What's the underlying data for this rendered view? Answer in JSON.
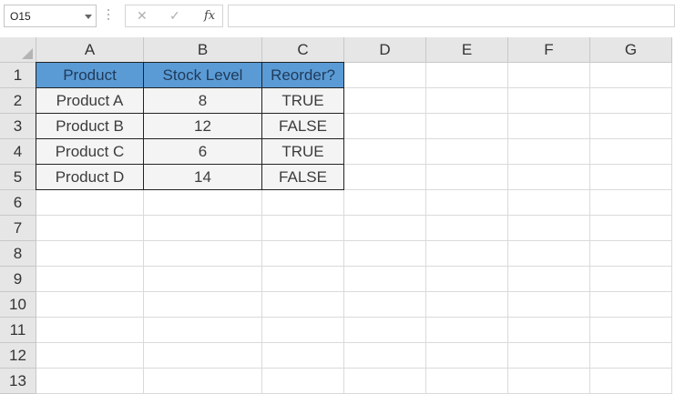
{
  "formula_bar": {
    "name_box": "O15",
    "cancel_icon": "✕",
    "enter_icon": "✓",
    "fx_label": "fx",
    "formula": ""
  },
  "columns": [
    "A",
    "B",
    "C",
    "D",
    "E",
    "F",
    "G"
  ],
  "rows": [
    "1",
    "2",
    "3",
    "4",
    "5",
    "6",
    "7",
    "8",
    "9",
    "10",
    "11",
    "12",
    "13"
  ],
  "table": {
    "headers": [
      "Product",
      "Stock Level",
      "Reorder?"
    ],
    "rows": [
      [
        "Product A",
        "8",
        "TRUE"
      ],
      [
        "Product B",
        "12",
        "FALSE"
      ],
      [
        "Product C",
        "6",
        "TRUE"
      ],
      [
        "Product D",
        "14",
        "FALSE"
      ]
    ]
  },
  "colors": {
    "header_fill": "#5b9bd5",
    "data_fill": "#f4f4f4",
    "grid_line": "#dadada",
    "header_bg": "#e6e6e6"
  }
}
